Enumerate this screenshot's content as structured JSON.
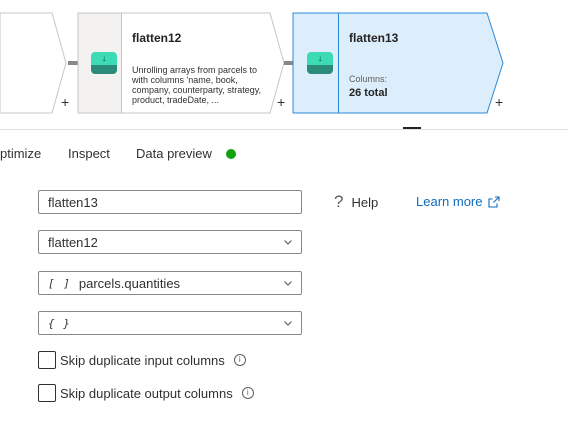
{
  "flow": {
    "nodes": [
      {
        "title": "flatten12",
        "description": "Unrolling arrays from parcels to  with columns 'name, book, company, counterparty, strategy, product, tradeDate, ...",
        "plus": "+"
      },
      {
        "title": "flatten13",
        "columns_label": "Columns:",
        "columns_total": "26 total",
        "plus": "+"
      }
    ],
    "prev_plus": "+",
    "icon": "flatten-icon",
    "selected_fill": "#dcedfb",
    "selected_border": "#2b88d8"
  },
  "tabs": {
    "optimize": "ptimize",
    "inspect": "Inspect",
    "data_preview": "Data preview",
    "status_color": "#13a10e"
  },
  "form": {
    "output_stream_name": "flatten13",
    "incoming_stream": "flatten12",
    "unroll_by_prefix": "[ ]",
    "unroll_by": "parcels.quantities",
    "unroll_root_prefix": "{ }",
    "skip_dup_input": "Skip duplicate input columns",
    "skip_dup_output": "Skip duplicate output columns",
    "info_glyph": "i"
  },
  "help": {
    "icon": "question-icon",
    "label": "Help",
    "learn_more": "Learn more",
    "link_color": "#0f6cbd"
  }
}
